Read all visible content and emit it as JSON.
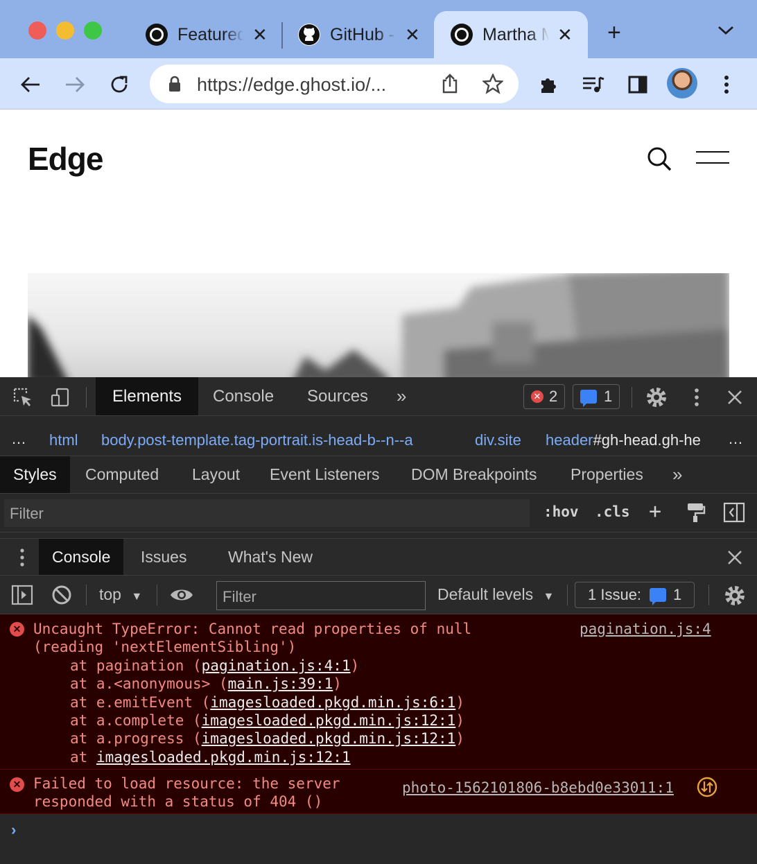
{
  "browser": {
    "tabs": [
      {
        "title": "Featured"
      },
      {
        "title": "GitHub - "
      },
      {
        "title": "Martha Milanov"
      }
    ],
    "url": "https://edge.ghost.io/..."
  },
  "page": {
    "site_title": "Edge"
  },
  "devtools": {
    "tabs": [
      "Elements",
      "Console",
      "Sources"
    ],
    "error_count": "2",
    "message_count": "1",
    "breadcrumbs": [
      {
        "tag": "html",
        "rest": ""
      },
      {
        "tag": "body",
        "rest": ".post-template.tag-portrait.is-head-b--n--a"
      },
      {
        "tag": "div",
        "rest": ".site"
      },
      {
        "tag": "header",
        "rest": "#gh-head.gh-he"
      }
    ],
    "panel_tabs": [
      "Styles",
      "Computed",
      "Layout",
      "Event Listeners",
      "DOM Breakpoints",
      "Properties"
    ],
    "filter_placeholder": "Filter",
    "hov": ":hov",
    "cls": ".cls",
    "drawer_tabs": [
      "Console",
      "Issues",
      "What's New"
    ],
    "console": {
      "context": "top",
      "filter_placeholder": "Filter",
      "levels": "Default levels",
      "issues_label": "1 Issue:",
      "issues_count": "1",
      "messages": [
        {
          "source": "pagination.js:4",
          "line1": "Uncaught TypeError: Cannot read properties of null",
          "line2": "(reading 'nextElementSibling')",
          "stack": [
            {
              "prefix": "at pagination (",
              "link": "pagination.js:4:1",
              "suffix": ")"
            },
            {
              "prefix": "at a.<anonymous> (",
              "link": "main.js:39:1",
              "suffix": ")"
            },
            {
              "prefix": "at e.emitEvent (",
              "link": "imagesloaded.pkgd.min.js:6:1",
              "suffix": ")"
            },
            {
              "prefix": "at a.complete (",
              "link": "imagesloaded.pkgd.min.js:12:1",
              "suffix": ")"
            },
            {
              "prefix": "at a.progress (",
              "link": "imagesloaded.pkgd.min.js:12:1",
              "suffix": ")"
            },
            {
              "prefix": "at ",
              "link": "imagesloaded.pkgd.min.js:12:1",
              "suffix": ""
            }
          ]
        },
        {
          "source": "photo-1562101806-b8ebd0e33011:1",
          "line1": "Failed to load resource: the server",
          "line2": "responded with a status of 404 ()"
        }
      ]
    }
  }
}
